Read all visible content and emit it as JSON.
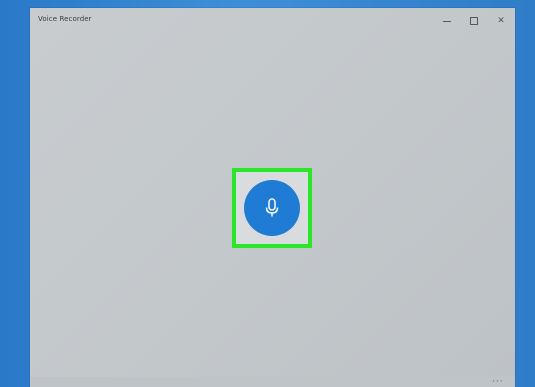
{
  "window": {
    "title": "Voice Recorder"
  },
  "titlebar_buttons": {
    "minimize_icon": "minimize-icon",
    "maximize_icon": "maximize-icon",
    "close_icon": "close-icon",
    "close_glyph": "✕"
  },
  "main": {
    "record_button_icon": "microphone-icon",
    "highlight_color": "#28e628",
    "accent_color": "#1f7bd4"
  },
  "footer": {
    "more_glyph": "···"
  }
}
